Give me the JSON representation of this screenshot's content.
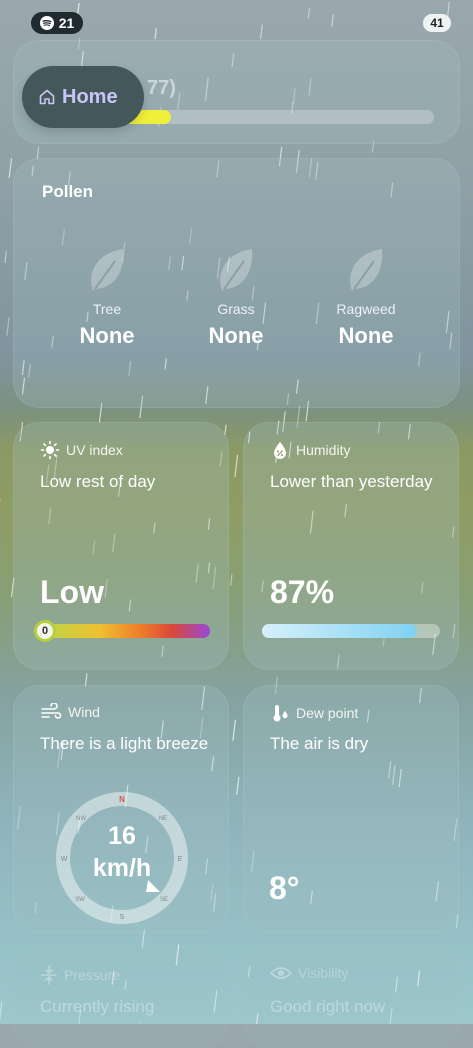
{
  "status_bar": {
    "left_badge": "21",
    "right_badge": "41",
    "app_icon": "spotify-icon"
  },
  "air_quality": {
    "value_text": "77)",
    "level": 0.15
  },
  "home_button": {
    "label": "Home",
    "icon": "home-icon"
  },
  "pollen": {
    "title": "Pollen",
    "items": [
      {
        "label": "Tree",
        "value": "None"
      },
      {
        "label": "Grass",
        "value": "None"
      },
      {
        "label": "Ragweed",
        "value": "None"
      }
    ]
  },
  "uv": {
    "title": "UV index",
    "icon": "sun-icon",
    "desc": "Low rest of day",
    "value": "Low",
    "index_label": "0",
    "index_value": 0
  },
  "humidity": {
    "title": "Humidity",
    "icon": "drop-percent-icon",
    "desc": "Lower than yesterday",
    "value": "87%",
    "percent": 87
  },
  "wind": {
    "title": "Wind",
    "icon": "wind-icon",
    "desc": "There is a light breeze",
    "speed": "16",
    "unit": "km/h",
    "compass": {
      "n": "N",
      "ne": "NE",
      "e": "E",
      "se": "SE",
      "s": "S",
      "sw": "SW",
      "w": "W",
      "nw": "NW"
    }
  },
  "dew_point": {
    "title": "Dew point",
    "icon": "thermometer-icon",
    "desc": "The air is dry",
    "value": "8°"
  },
  "pressure": {
    "title": "Pressure",
    "icon": "pressure-icon",
    "desc": "Currently rising"
  },
  "visibility": {
    "title": "Visibility",
    "icon": "eye-icon",
    "desc": "Good right now"
  },
  "colors": {
    "home_text": "#c9c6f6",
    "aqi_fill": "#f0f03a",
    "humidity_fill": "#7fd2f3"
  }
}
